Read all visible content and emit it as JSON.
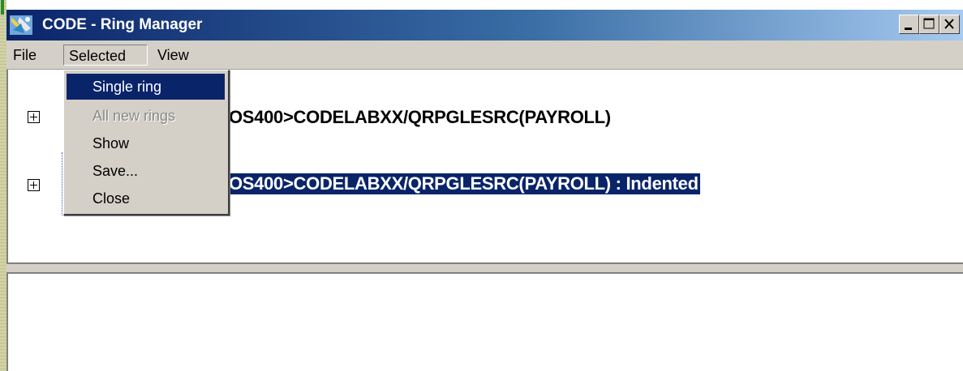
{
  "window": {
    "title": "CODE - Ring Manager",
    "title_gradient": [
      "#0a246a",
      "#a6caf0"
    ],
    "controls": [
      "minimize-icon",
      "maximize-icon",
      "close-icon"
    ]
  },
  "menubar": {
    "items": [
      {
        "label": "File"
      },
      {
        "label": "Selected",
        "open": true
      },
      {
        "label": "View"
      }
    ]
  },
  "dropdown": {
    "items": [
      {
        "label": "Single ring",
        "state": "highlighted"
      },
      {
        "label": "All new rings",
        "state": "disabled"
      },
      {
        "label": "Show",
        "state": "normal"
      },
      {
        "label": "Save...",
        "state": "normal"
      },
      {
        "label": "Close",
        "state": "normal"
      }
    ]
  },
  "tree": {
    "items": [
      {
        "label_visible": "OS400>CODELABXX/QRPGLESRC(PAYROLL)",
        "selected": false,
        "icon": "plus-expander-icon"
      },
      {
        "label_visible": "OS400>CODELABXX/QRPGLESRC(PAYROLL) : Indented",
        "selected": true,
        "icon": "plus-expander-icon"
      }
    ]
  },
  "colors": {
    "selection": "#0a246a",
    "chrome": "#d4d0c8"
  }
}
